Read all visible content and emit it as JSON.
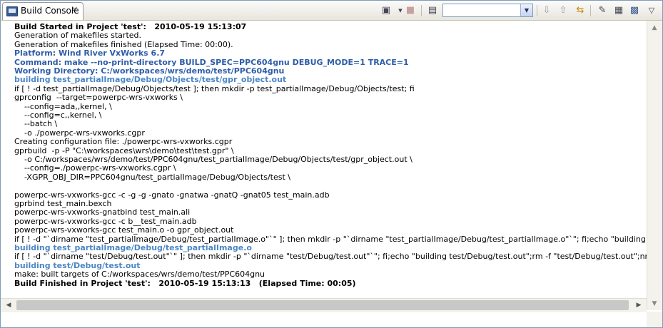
{
  "view": {
    "tab_label": "Build Console",
    "tab_close": "✕"
  },
  "toolbar": {
    "icons": {
      "pin": "▣",
      "stop": "■",
      "display": "▤",
      "down": "⇩",
      "up": "⇧",
      "link": "⇆",
      "clear": "✎",
      "lock": "▦",
      "save": "▩",
      "menu": "▽"
    },
    "combo_value": "",
    "combo_arrow": "▼"
  },
  "console": {
    "lines": [
      {
        "text": "Build Started in Project 'test':   2010-05-19 15:13:07",
        "style": "bold"
      },
      {
        "text": "Generation of makefiles started.",
        "style": "normal"
      },
      {
        "text": "Generation of makefiles finished (Elapsed Time: 00:00).",
        "style": "normal"
      },
      {
        "text": "Platform: Wind River VxWorks 6.7",
        "style": "blue"
      },
      {
        "text": "Command: make --no-print-directory BUILD_SPEC=PPC604gnu DEBUG_MODE=1 TRACE=1",
        "style": "blue"
      },
      {
        "text": "Working Directory: C:/workspaces/wrs/demo/test/PPC604gnu",
        "style": "blue"
      },
      {
        "text": "building test_partialImage/Debug/Objects/test/gpr_object.out",
        "style": "blue2"
      },
      {
        "text": "if [ ! -d test_partialImage/Debug/Objects/test ]; then mkdir -p test_partialImage/Debug/Objects/test; fi",
        "style": "normal"
      },
      {
        "text": "gprconfig  --target=powerpc-wrs-vxworks \\",
        "style": "normal"
      },
      {
        "text": "    --config=ada,,kernel, \\",
        "style": "normal"
      },
      {
        "text": "    --config=c,,kernel, \\",
        "style": "normal"
      },
      {
        "text": "    --batch \\",
        "style": "normal"
      },
      {
        "text": "    -o ./powerpc-wrs-vxworks.cgpr",
        "style": "normal"
      },
      {
        "text": "Creating configuration file: ./powerpc-wrs-vxworks.cgpr",
        "style": "normal"
      },
      {
        "text": "gprbuild  -p -P \"C:\\workspaces\\wrs\\demo\\test\\test.gpr\" \\",
        "style": "normal"
      },
      {
        "text": "    -o C:/workspaces/wrs/demo/test/PPC604gnu/test_partialImage/Debug/Objects/test/gpr_object.out \\",
        "style": "normal"
      },
      {
        "text": "    --config=./powerpc-wrs-vxworks.cgpr \\",
        "style": "normal"
      },
      {
        "text": "    -XGPR_OBJ_DIR=PPC604gnu/test_partialImage/Debug/Objects/test \\",
        "style": "normal"
      },
      {
        "text": "",
        "style": "normal"
      },
      {
        "text": "powerpc-wrs-vxworks-gcc -c -g -g -gnato -gnatwa -gnatQ -gnat05 test_main.adb",
        "style": "normal"
      },
      {
        "text": "gprbind test_main.bexch",
        "style": "normal"
      },
      {
        "text": "powerpc-wrs-vxworks-gnatbind test_main.ali",
        "style": "normal"
      },
      {
        "text": "powerpc-wrs-vxworks-gcc -c b__test_main.adb",
        "style": "normal"
      },
      {
        "text": "powerpc-wrs-vxworks-gcc test_main.o -o gpr_object.out",
        "style": "normal"
      },
      {
        "text": "if [ ! -d \"`dirname \"test_partialImage/Debug/test_partialImage.o\"`\" ]; then mkdir -p \"`dirname \"test_partialImage/Debug/test_partialImage.o\"`\"; fi;echo \"building test_partialImage/Deb",
        "style": "normal"
      },
      {
        "text": "building test_partialImage/Debug/test_partialImage.o",
        "style": "blue2"
      },
      {
        "text": "if [ ! -d \"`dirname \"test/Debug/test.out\"`\" ]; then mkdir -p \"`dirname \"test/Debug/test.out\"`\"; fi;echo \"building test/Debug/test.out\";rm -f \"test/Debug/test.out\";nmppc test_partialImag",
        "style": "normal"
      },
      {
        "text": "building test/Debug/test.out",
        "style": "blue2"
      },
      {
        "text": "make: built targets of C:/workspaces/wrs/demo/test/PPC604gnu",
        "style": "normal"
      },
      {
        "text": "Build Finished in Project 'test':   2010-05-19 15:13:13   (Elapsed Time: 00:05)",
        "style": "bold"
      }
    ]
  },
  "scrollbars": {
    "up_arrow": "▲",
    "down_arrow": "▼",
    "left_arrow": "◀",
    "right_arrow": "▶"
  }
}
